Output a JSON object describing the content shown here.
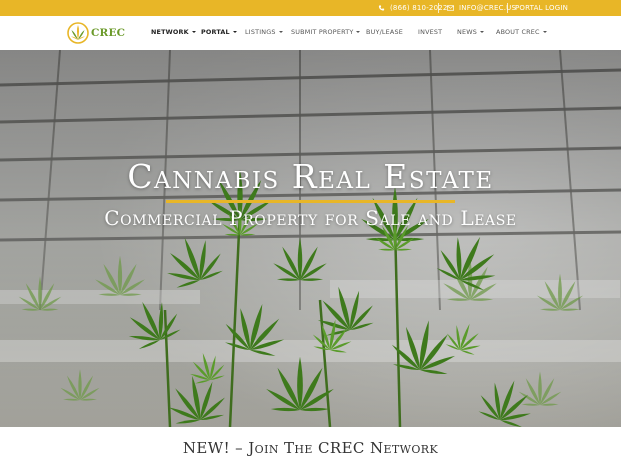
{
  "topbar": {
    "phone": "(866) 810-2022",
    "email": "INFO@CREC.US",
    "login": "PORTAL LOGIN",
    "phone_icon": "phone-icon",
    "email_icon": "envelope-icon",
    "color": "#e8b627"
  },
  "logo": {
    "text": "CREC",
    "icon": "leaf-logo-icon"
  },
  "nav": {
    "items": [
      {
        "label": "NETWORK",
        "dropdown": true
      },
      {
        "label": "PORTAL",
        "dropdown": true
      },
      {
        "label": "LISTINGS",
        "dropdown": true
      },
      {
        "label": "SUBMIT PROPERTY",
        "dropdown": true
      },
      {
        "label": "BUY/LEASE",
        "dropdown": false
      },
      {
        "label": "INVEST",
        "dropdown": false
      },
      {
        "label": "NEWS",
        "dropdown": true
      },
      {
        "label": "ABOUT CREC",
        "dropdown": true
      }
    ]
  },
  "hero": {
    "title": "Cannabis Real Estate",
    "subtitle": "Commercial Property for Sale and Lease",
    "accent": "#e8b627"
  },
  "bottom": {
    "title": "NEW! – Join The CREC Network"
  }
}
